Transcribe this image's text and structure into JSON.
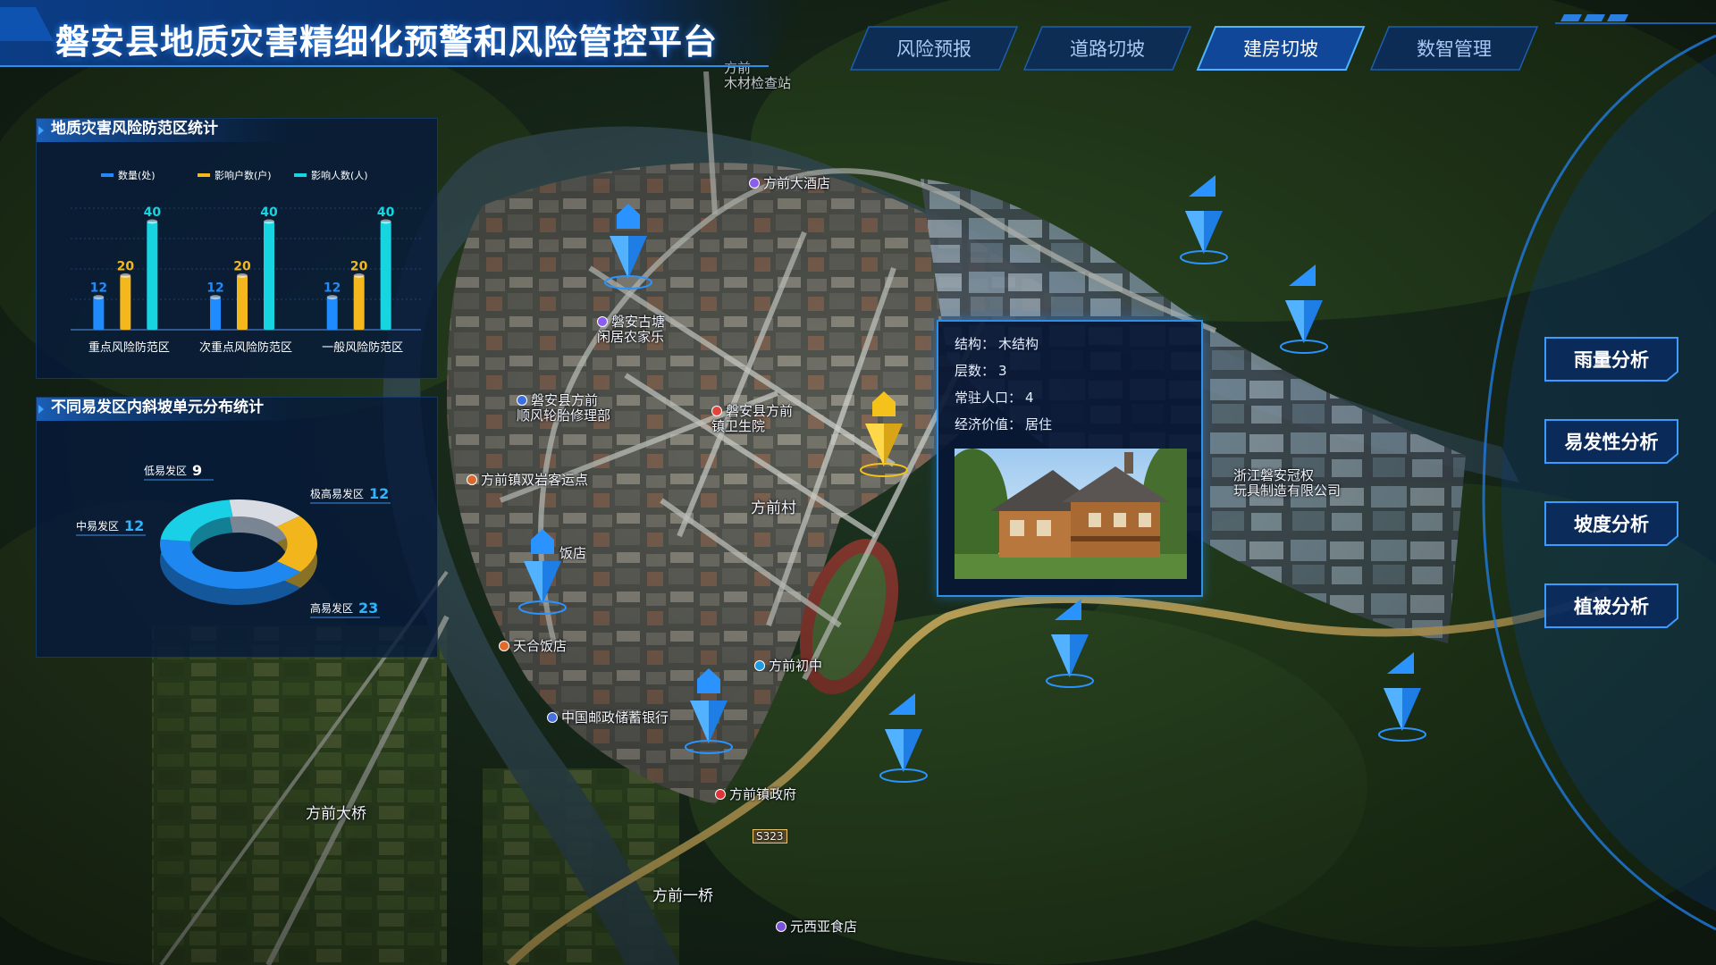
{
  "header": {
    "title": "磐安县地质灾害精细化预警和风险管控平台",
    "tabs": [
      {
        "label": "风险预报",
        "active": false
      },
      {
        "label": "道路切坡",
        "active": false
      },
      {
        "label": "建房切坡",
        "active": true
      },
      {
        "label": "数智管理",
        "active": false
      }
    ]
  },
  "risk_panel": {
    "title": "地质灾害风险防范区统计",
    "legend": [
      "数量(处)",
      "影响户数(户)",
      "影响人数(人)"
    ]
  },
  "slope_panel": {
    "title": "不同易发区内斜坡单元分布统计",
    "segments": [
      {
        "label": "低易发区",
        "value": 9
      },
      {
        "label": "极高易发区",
        "value": 12
      },
      {
        "label": "中易发区",
        "value": 12
      },
      {
        "label": "高易发区",
        "value": 23
      }
    ]
  },
  "chart_data": [
    {
      "type": "bar",
      "title": "地质灾害风险防范区统计",
      "categories": [
        "重点风险防范区",
        "次重点风险防范区",
        "一般风险防范区"
      ],
      "series": [
        {
          "name": "数量(处)",
          "values": [
            12,
            12,
            12
          ]
        },
        {
          "name": "影响户数(户)",
          "values": [
            20,
            20,
            20
          ]
        },
        {
          "name": "影响人数(人)",
          "values": [
            40,
            40,
            40
          ]
        }
      ],
      "ylim": [
        0,
        45
      ],
      "grid": true,
      "legend": "top"
    },
    {
      "type": "pie",
      "title": "不同易发区内斜坡单元分布统计",
      "categories": [
        "低易发区",
        "极高易发区",
        "中易发区",
        "高易发区"
      ],
      "values": [
        9,
        12,
        12,
        23
      ]
    }
  ],
  "popup": {
    "rows": [
      {
        "key": "结构：",
        "value": "木结构"
      },
      {
        "key": "层数：",
        "value": "3"
      },
      {
        "key": "常驻人口：",
        "value": "4"
      },
      {
        "key": "经济价值：",
        "value": "居住"
      }
    ]
  },
  "side_buttons": [
    "雨量分析",
    "易发性分析",
    "坡度分析",
    "植被分析"
  ],
  "map_labels": {
    "hotel": "方前大酒店",
    "farmhouse": "磐安古塘\n闲居农家乐",
    "repair": "磐安县方前\n顺风轮胎修理部",
    "clinic": "磐安县方前\n镇卫生院",
    "bus": "方前镇双岩客运点",
    "village": "方前村",
    "restaurant1": "饭店",
    "restaurant2": "天合饭店",
    "school": "方前初中",
    "bank": "中国邮政储蓄银行",
    "gov": "方前镇政府",
    "bridge1": "方前大桥",
    "bridge2": "方前一桥",
    "canteen": "元西亚食店",
    "factory": "浙江磐安冠权\n玩具制造有限公司",
    "wood": "方前\n木材检查站",
    "road": "S323"
  },
  "colors": {
    "series_blue": "#1e8cff",
    "series_gold": "#f5b81c",
    "series_cyan": "#17d5e0",
    "accent": "#2d8fe6"
  }
}
